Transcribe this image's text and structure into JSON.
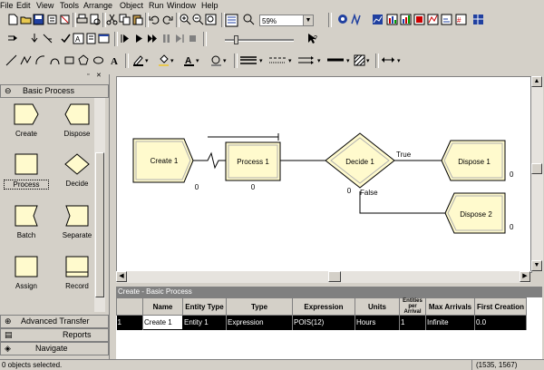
{
  "menu": [
    "File",
    "Edit",
    "View",
    "Tools",
    "Arrange",
    "Object",
    "Run",
    "Window",
    "Help"
  ],
  "toolbar": {
    "zoom_value": "59%"
  },
  "project_bar": {
    "active_panel": "Basic Process",
    "modules": [
      "Create",
      "Dispose",
      "Process",
      "Decide",
      "Batch",
      "Separate",
      "Assign",
      "Record"
    ],
    "bottom_panels": [
      "Advanced Transfer",
      "Reports",
      "Navigate"
    ]
  },
  "flowchart": {
    "nodes": {
      "create": "Create 1",
      "process": "Process 1",
      "decide": "Decide 1",
      "dispose1": "Dispose 1",
      "dispose2": "Dispose 2"
    },
    "counters": {
      "create": "0",
      "process": "0",
      "decide": "0",
      "dispose1": "0",
      "dispose2": "0"
    },
    "branch_labels": {
      "true": "True",
      "false": "False"
    }
  },
  "spreadsheet": {
    "title": "Create - Basic Process",
    "columns": [
      "",
      "Name",
      "Entity Type",
      "Type",
      "Expression",
      "Units",
      "Entities per Arrival",
      "Max Arrivals",
      "First Creation"
    ],
    "rows": [
      [
        "1",
        "Create 1",
        "Entity 1",
        "Expression",
        "POIS(12)",
        "Hours",
        "1",
        "Infinite",
        "0.0"
      ]
    ]
  },
  "status": {
    "left": "0 objects selected.",
    "right": "(1535, 1567)"
  }
}
